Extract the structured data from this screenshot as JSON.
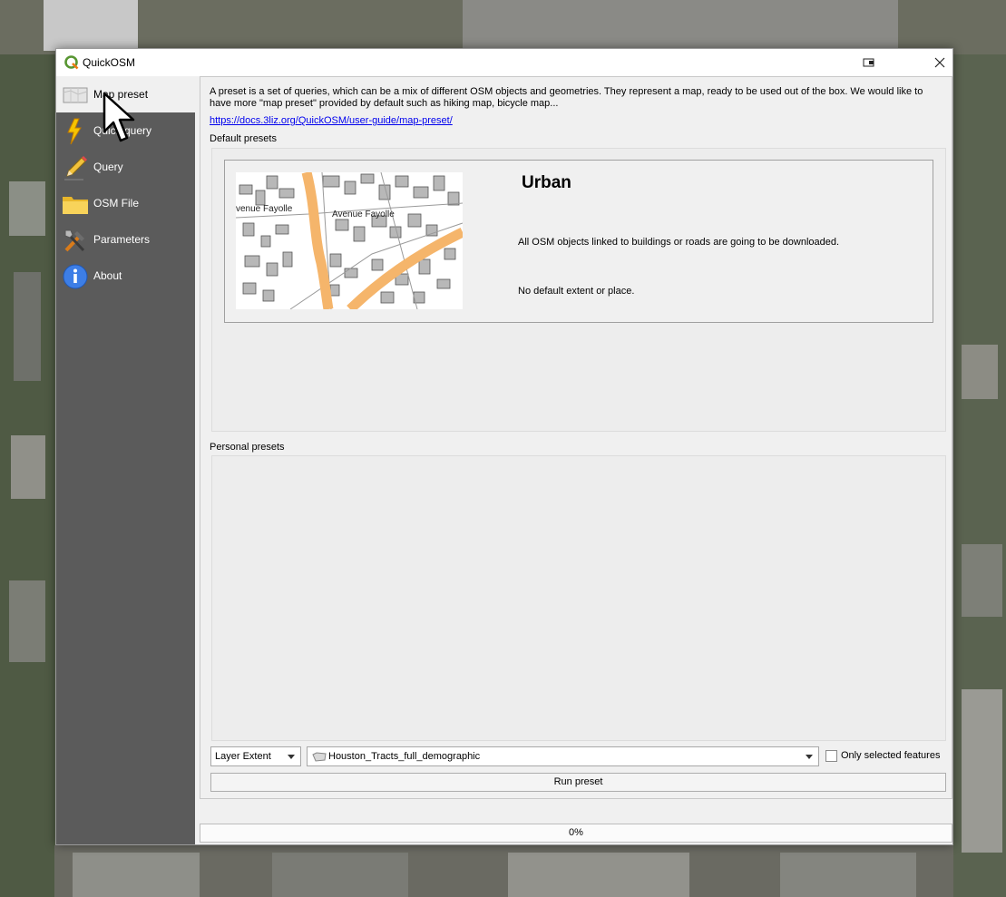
{
  "window": {
    "title": "QuickOSM"
  },
  "sidebar": {
    "items": [
      {
        "label": "Map preset",
        "icon": "map-icon",
        "active": true
      },
      {
        "label": "Quick query",
        "icon": "lightning-icon",
        "active": false
      },
      {
        "label": "Query",
        "icon": "pencil-icon",
        "active": false
      },
      {
        "label": "OSM File",
        "icon": "folder-icon",
        "active": false
      },
      {
        "label": "Parameters",
        "icon": "tools-icon",
        "active": false
      },
      {
        "label": "About",
        "icon": "info-icon",
        "active": false
      }
    ]
  },
  "main": {
    "intro": "A preset is a set of queries, which can be a mix of different OSM objects and geometries. They represent a map, ready to be used out of the box. We would like to have more \"map preset\" provided by default such as hiking map, bicycle map...",
    "doc_link": "https://docs.3liz.org/QuickOSM/user-guide/map-preset/",
    "default_presets_label": "Default presets",
    "personal_presets_label": "Personal presets",
    "preset": {
      "name": "Urban",
      "description": "All OSM objects linked to buildings or roads are going to be downloaded.",
      "extent": "No default extent or place.",
      "thumbnail_labels": [
        "venue Fayolle",
        "Avenue Fayolle"
      ]
    },
    "extent_select": {
      "value": "Layer Extent"
    },
    "layer_select": {
      "value": "Houston_Tracts_full_demographic"
    },
    "only_selected": {
      "label": "Only selected features",
      "checked": false
    },
    "run_button": "Run preset",
    "progress": {
      "text": "0%",
      "value": 0
    }
  },
  "colors": {
    "sidebar_bg": "#5b5b5b",
    "road": "#f5b56b",
    "building": "#b5b5b5",
    "link": "#0000ee"
  }
}
